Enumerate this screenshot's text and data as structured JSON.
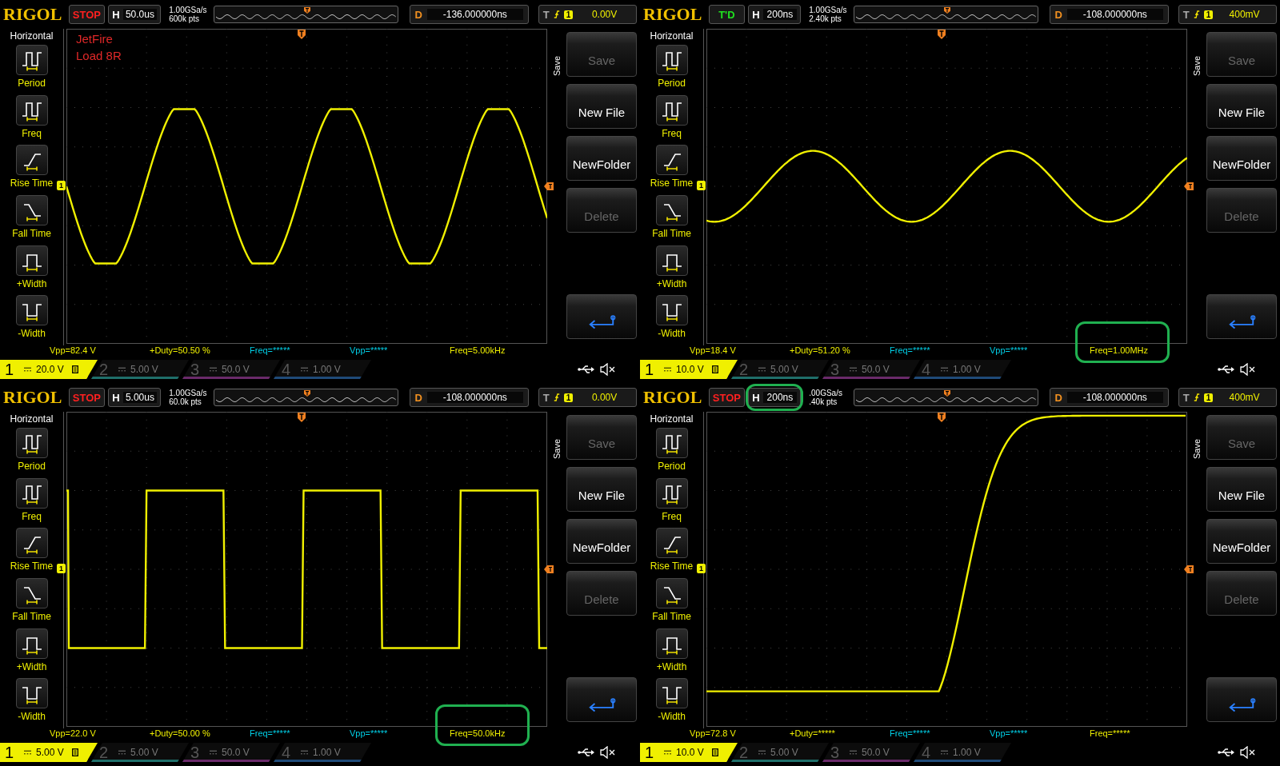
{
  "scopes": [
    {
      "logo": "RIGOL",
      "status": {
        "text": "STOP",
        "kind": "stop"
      },
      "timebase_label": "H",
      "timebase": {
        "value": "50.0us",
        "highlighted": false
      },
      "sample_rate": "1.00GSa/s",
      "memory_depth": "600k pts",
      "delay_label": "D",
      "delay": "-136.000000ns",
      "trigger_label": "T",
      "trigger_source": "1",
      "trigger_level": "0.00V",
      "sidebar": {
        "title": "Horizontal",
        "items": [
          {
            "label": "Period",
            "kind": "period"
          },
          {
            "label": "Freq",
            "kind": "freq"
          },
          {
            "label": "Rise Time",
            "kind": "rise"
          },
          {
            "label": "Fall Time",
            "kind": "fall"
          },
          {
            "label": "+Width",
            "kind": "pwidth"
          },
          {
            "label": "-Width",
            "kind": "nwidth"
          }
        ]
      },
      "notes": [
        "JetFire",
        "Load 8R"
      ],
      "channel_marker": "1",
      "waveform": {
        "kind": "clipped-sine"
      },
      "menu": {
        "title": "Save",
        "items": [
          {
            "label": "Save",
            "disabled": true
          },
          {
            "label": "New File",
            "disabled": false
          },
          {
            "label": "NewFolder",
            "disabled": false
          },
          {
            "label": "Delete",
            "disabled": true
          }
        ]
      },
      "measurements": [
        {
          "text": "Vpp=82.4 V",
          "color": "#f0f000",
          "highlighted": false
        },
        {
          "text": "+Duty=50.50 %",
          "color": "#f0f000",
          "highlighted": false
        },
        {
          "text": "Freq=*****",
          "color": "#00d0e8",
          "highlighted": false
        },
        {
          "text": "Vpp=*****",
          "color": "#00d0e8",
          "highlighted": false
        },
        {
          "text": "Freq=5.00kHz",
          "color": "#f0f000",
          "highlighted": false
        }
      ],
      "channels": [
        {
          "number": "1",
          "scale": "20.0 V",
          "selected": true,
          "color": "#f0f000",
          "bw_limit": true
        },
        {
          "number": "2",
          "scale": "5.00 V",
          "selected": false,
          "color": "#1f6f6a",
          "bw_limit": false
        },
        {
          "number": "3",
          "scale": "50.0 V",
          "selected": false,
          "color": "#6a2a6a",
          "bw_limit": false
        },
        {
          "number": "4",
          "scale": "1.00 V",
          "selected": false,
          "color": "#1f4a78",
          "bw_limit": false
        }
      ]
    },
    {
      "logo": "RIGOL",
      "status": {
        "text": "T'D",
        "kind": "triggered"
      },
      "timebase_label": "H",
      "timebase": {
        "value": "200ns",
        "highlighted": false
      },
      "sample_rate": "1.00GSa/s",
      "memory_depth": "2.40k pts",
      "delay_label": "D",
      "delay": "-108.000000ns",
      "trigger_label": "T",
      "trigger_source": "1",
      "trigger_level": "400mV",
      "sidebar": {
        "title": "Horizontal",
        "items": [
          {
            "label": "Period",
            "kind": "period"
          },
          {
            "label": "Freq",
            "kind": "freq"
          },
          {
            "label": "Rise Time",
            "kind": "rise"
          },
          {
            "label": "Fall Time",
            "kind": "fall"
          },
          {
            "label": "+Width",
            "kind": "pwidth"
          },
          {
            "label": "-Width",
            "kind": "nwidth"
          }
        ]
      },
      "channel_marker": "1",
      "waveform": {
        "kind": "sine"
      },
      "menu": {
        "title": "Save",
        "items": [
          {
            "label": "Save",
            "disabled": true
          },
          {
            "label": "New File",
            "disabled": false
          },
          {
            "label": "NewFolder",
            "disabled": false
          },
          {
            "label": "Delete",
            "disabled": true
          }
        ]
      },
      "measurements": [
        {
          "text": "Vpp=18.4 V",
          "color": "#f0f000",
          "highlighted": false
        },
        {
          "text": "+Duty=51.20 %",
          "color": "#f0f000",
          "highlighted": false
        },
        {
          "text": "Freq=*****",
          "color": "#00d0e8",
          "highlighted": false
        },
        {
          "text": "Vpp=*****",
          "color": "#00d0e8",
          "highlighted": false
        },
        {
          "text": "Freq=1.00MHz",
          "color": "#f0f000",
          "highlighted": true
        }
      ],
      "channels": [
        {
          "number": "1",
          "scale": "10.0 V",
          "selected": true,
          "color": "#f0f000",
          "bw_limit": true
        },
        {
          "number": "2",
          "scale": "5.00 V",
          "selected": false,
          "color": "#1f6f6a",
          "bw_limit": false
        },
        {
          "number": "3",
          "scale": "50.0 V",
          "selected": false,
          "color": "#6a2a6a",
          "bw_limit": false
        },
        {
          "number": "4",
          "scale": "1.00 V",
          "selected": false,
          "color": "#1f4a78",
          "bw_limit": false
        }
      ]
    },
    {
      "logo": "RIGOL",
      "status": {
        "text": "STOP",
        "kind": "stop"
      },
      "timebase_label": "H",
      "timebase": {
        "value": "5.00us",
        "highlighted": false
      },
      "sample_rate": "1.00GSa/s",
      "memory_depth": "60.0k pts",
      "delay_label": "D",
      "delay": "-108.000000ns",
      "trigger_label": "T",
      "trigger_source": "1",
      "trigger_level": "0.00V",
      "sidebar": {
        "title": "Horizontal",
        "items": [
          {
            "label": "Period",
            "kind": "period"
          },
          {
            "label": "Freq",
            "kind": "freq"
          },
          {
            "label": "Rise Time",
            "kind": "rise"
          },
          {
            "label": "Fall Time",
            "kind": "fall"
          },
          {
            "label": "+Width",
            "kind": "pwidth"
          },
          {
            "label": "-Width",
            "kind": "nwidth"
          }
        ]
      },
      "channel_marker": "1",
      "waveform": {
        "kind": "square"
      },
      "menu": {
        "title": "Save",
        "items": [
          {
            "label": "Save",
            "disabled": true
          },
          {
            "label": "New File",
            "disabled": false
          },
          {
            "label": "NewFolder",
            "disabled": false
          },
          {
            "label": "Delete",
            "disabled": true
          }
        ]
      },
      "measurements": [
        {
          "text": "Vpp=22.0 V",
          "color": "#f0f000",
          "highlighted": false
        },
        {
          "text": "+Duty=50.00 %",
          "color": "#f0f000",
          "highlighted": false
        },
        {
          "text": "Freq=*****",
          "color": "#00d0e8",
          "highlighted": false
        },
        {
          "text": "Vpp=*****",
          "color": "#00d0e8",
          "highlighted": false
        },
        {
          "text": "Freq=50.0kHz",
          "color": "#f0f000",
          "highlighted": true
        }
      ],
      "channels": [
        {
          "number": "1",
          "scale": "5.00 V",
          "selected": true,
          "color": "#f0f000",
          "bw_limit": true
        },
        {
          "number": "2",
          "scale": "5.00 V",
          "selected": false,
          "color": "#1f6f6a",
          "bw_limit": false
        },
        {
          "number": "3",
          "scale": "50.0 V",
          "selected": false,
          "color": "#6a2a6a",
          "bw_limit": false
        },
        {
          "number": "4",
          "scale": "1.00 V",
          "selected": false,
          "color": "#1f4a78",
          "bw_limit": false
        }
      ]
    },
    {
      "logo": "RIGOL",
      "status": {
        "text": "STOP",
        "kind": "stop"
      },
      "timebase_label": "H",
      "timebase": {
        "value": "200ns",
        "highlighted": true
      },
      "sample_rate": ".00GSa/s",
      "memory_depth": ".40k pts",
      "delay_label": "D",
      "delay": "-108.000000ns",
      "trigger_label": "T",
      "trigger_source": "1",
      "trigger_level": "400mV",
      "sidebar": {
        "title": "Horizontal",
        "items": [
          {
            "label": "Period",
            "kind": "period"
          },
          {
            "label": "Freq",
            "kind": "freq"
          },
          {
            "label": "Rise Time",
            "kind": "rise"
          },
          {
            "label": "Fall Time",
            "kind": "fall"
          },
          {
            "label": "+Width",
            "kind": "pwidth"
          },
          {
            "label": "-Width",
            "kind": "nwidth"
          }
        ]
      },
      "channel_marker": "1",
      "waveform": {
        "kind": "step"
      },
      "menu": {
        "title": "Save",
        "items": [
          {
            "label": "Save",
            "disabled": true
          },
          {
            "label": "New File",
            "disabled": false
          },
          {
            "label": "NewFolder",
            "disabled": false
          },
          {
            "label": "Delete",
            "disabled": true
          }
        ]
      },
      "measurements": [
        {
          "text": "Vpp=72.8 V",
          "color": "#f0f000",
          "highlighted": false
        },
        {
          "text": "+Duty=*****",
          "color": "#f0f000",
          "highlighted": false
        },
        {
          "text": "Freq=*****",
          "color": "#00d0e8",
          "highlighted": false
        },
        {
          "text": "Vpp=*****",
          "color": "#00d0e8",
          "highlighted": false
        },
        {
          "text": "Freq=*****",
          "color": "#f0f000",
          "highlighted": false
        }
      ],
      "channels": [
        {
          "number": "1",
          "scale": "10.0 V",
          "selected": true,
          "color": "#f0f000",
          "bw_limit": true
        },
        {
          "number": "2",
          "scale": "5.00 V",
          "selected": false,
          "color": "#1f6f6a",
          "bw_limit": false
        },
        {
          "number": "3",
          "scale": "50.0 V",
          "selected": false,
          "color": "#6a2a6a",
          "bw_limit": false
        },
        {
          "number": "4",
          "scale": "1.00 V",
          "selected": false,
          "color": "#1f4a78",
          "bw_limit": false
        }
      ]
    }
  ]
}
